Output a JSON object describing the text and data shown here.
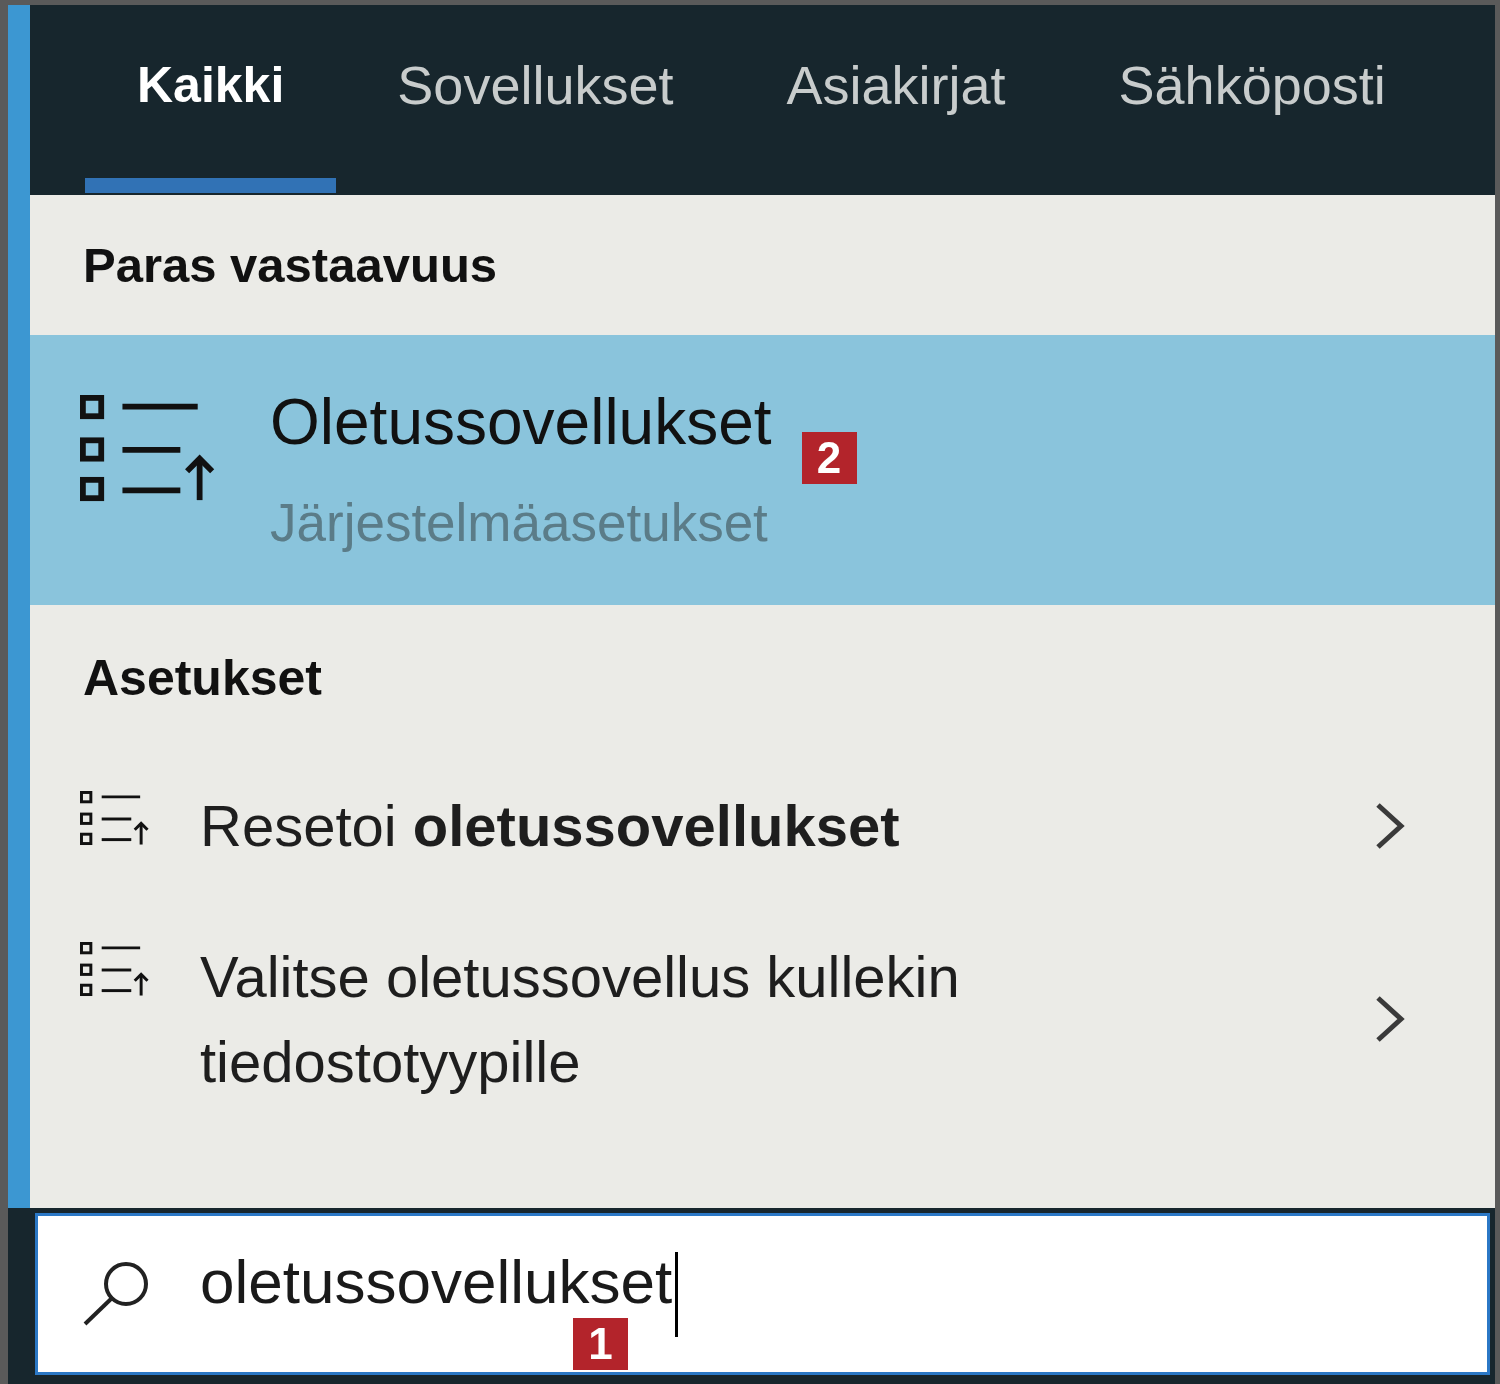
{
  "tabs": [
    {
      "label": "Kaikki",
      "selected": true
    },
    {
      "label": "Sovellukset",
      "selected": false
    },
    {
      "label": "Asiakirjat",
      "selected": false
    },
    {
      "label": "Sähköposti",
      "selected": false
    }
  ],
  "best_match": {
    "heading": "Paras vastaavuus",
    "title": "Oletussovellukset",
    "subtitle": "Järjestelmäasetukset",
    "selected": true,
    "callout": "2"
  },
  "settings": {
    "heading": "Asetukset",
    "items": [
      {
        "label": "Resetoi **oletussovellukset**",
        "selected": false
      },
      {
        "label": "Valitse oletussovellus kullekin tiedostotyypille",
        "selected": false
      }
    ]
  },
  "search": {
    "value": "oletussovellukset",
    "focused": true,
    "callout": "1"
  }
}
